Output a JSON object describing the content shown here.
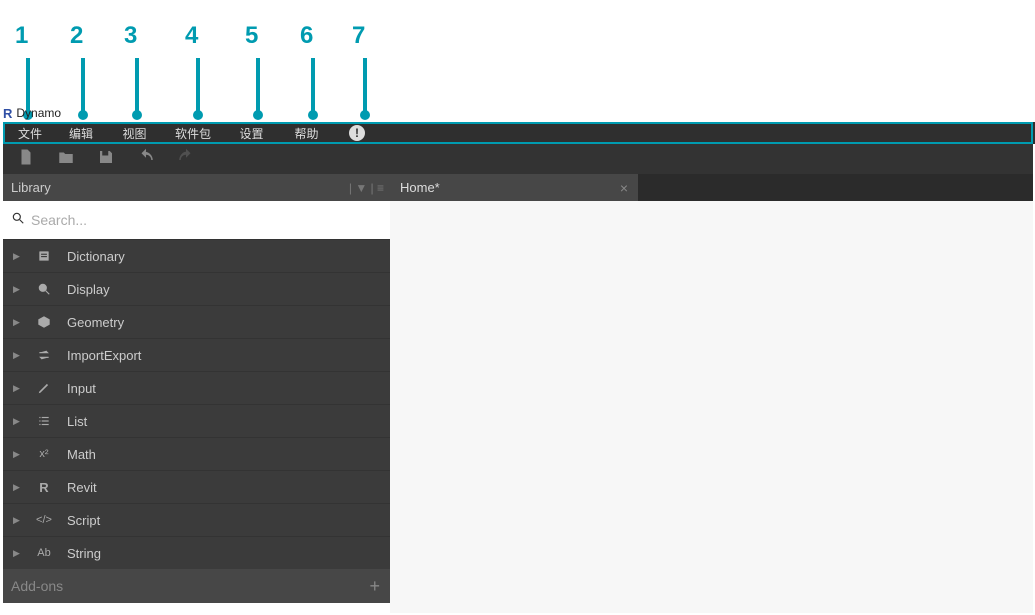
{
  "app": {
    "logo_letter": "R",
    "title": "Dynamo"
  },
  "menu": {
    "m1": "文件",
    "m2": "编辑",
    "m3": "视图",
    "m4": "软件包",
    "m5": "设置",
    "m6": "帮助",
    "info_glyph": "!"
  },
  "callouts": {
    "n1": "1",
    "n2": "2",
    "n3": "3",
    "n4": "4",
    "n5": "5",
    "n6": "6",
    "n7": "7"
  },
  "library": {
    "title": "Library",
    "header_icons": "|  ▼  |  ≡",
    "search_placeholder": "Search...",
    "addons_label": "Add-ons",
    "addons_plus": "+",
    "items": {
      "dictionary": "Dictionary",
      "display": "Display",
      "geometry": "Geometry",
      "importexport": "ImportExport",
      "input": "Input",
      "list": "List",
      "math": "Math",
      "revit": "Revit",
      "script": "Script",
      "string": "String"
    },
    "icon_text": {
      "math": "x²",
      "revit": "R",
      "script": "</>",
      "string": "Ab"
    }
  },
  "workspace": {
    "tab_label": "Home*",
    "tab_close": "×"
  }
}
